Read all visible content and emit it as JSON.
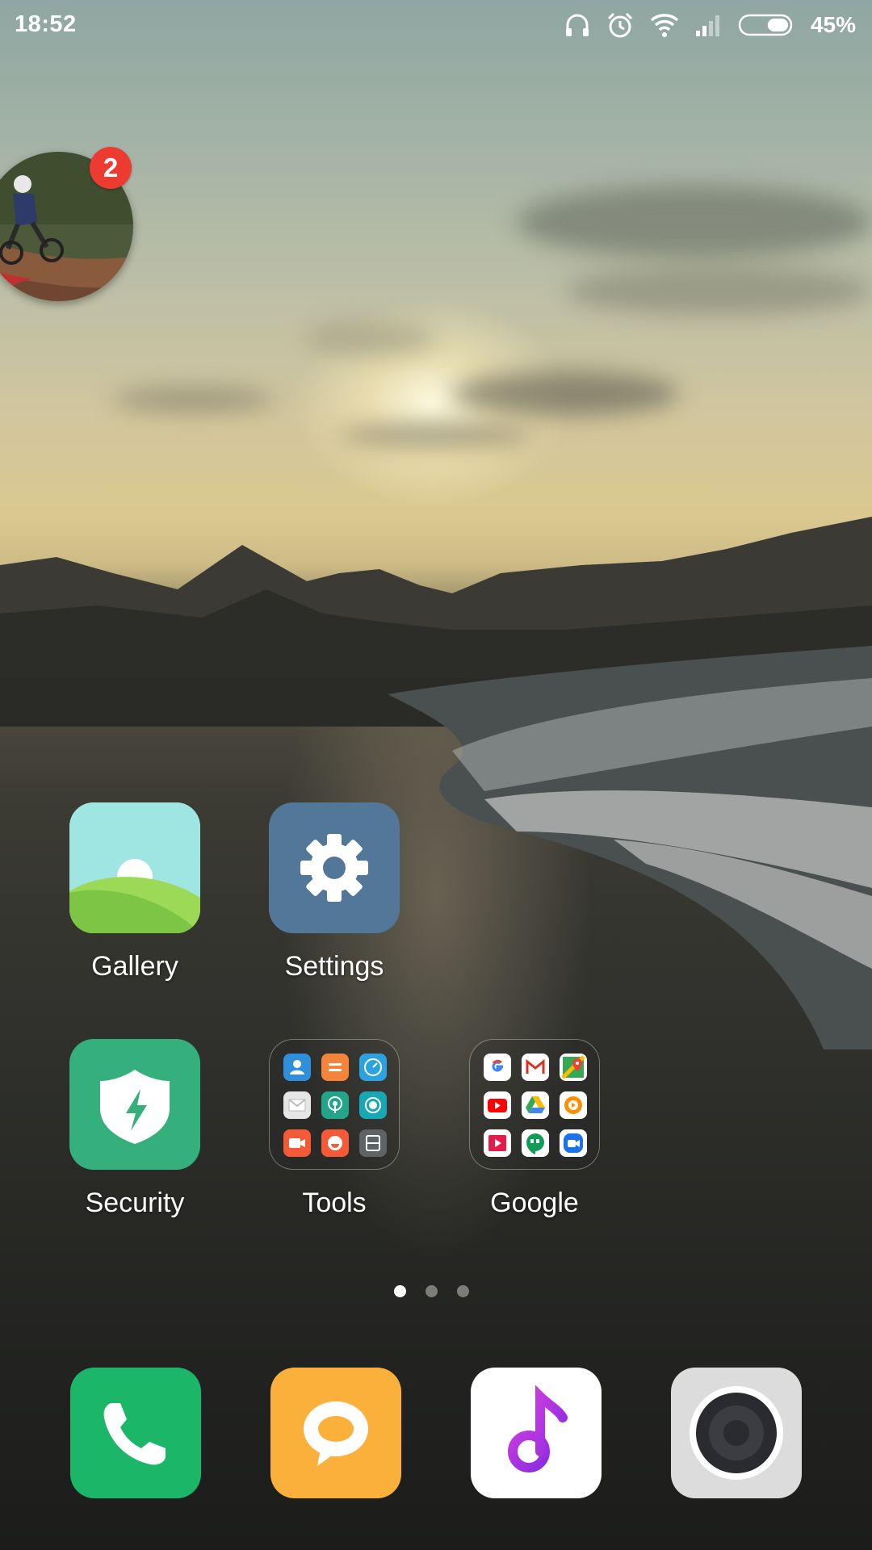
{
  "status_bar": {
    "time": "18:52",
    "battery_percent": "45%",
    "battery_level": 0.45,
    "icons": [
      "headphones-icon",
      "alarm-icon",
      "wifi-icon",
      "signal-icon",
      "battery-icon"
    ]
  },
  "chat_head": {
    "badge_count": "2"
  },
  "home": {
    "apps": [
      {
        "label": "Gallery",
        "icon": "gallery-icon",
        "color": "#8fd25a"
      },
      {
        "label": "Settings",
        "icon": "gear-icon",
        "color": "#527798"
      },
      {
        "label": "Security",
        "icon": "shield-bolt-icon",
        "color": "#35b07d"
      },
      {
        "label": "Tools",
        "icon": "folder-icon"
      },
      {
        "label": "Google",
        "icon": "folder-icon"
      }
    ],
    "tools_folder_icons": [
      "contacts-icon",
      "notes-icon",
      "compass-icon",
      "mail-icon",
      "radio-icon",
      "recorder-icon",
      "screen-recorder-icon",
      "feedback-icon",
      "scanner-icon"
    ],
    "google_folder_icons": [
      "google-icon",
      "gmail-icon",
      "maps-icon",
      "youtube-icon",
      "drive-icon",
      "play-music-icon",
      "play-movies-icon",
      "hangouts-icon",
      "duo-icon"
    ]
  },
  "pager": {
    "pages": 3,
    "current": 1
  },
  "dock": [
    {
      "name": "phone",
      "icon": "phone-icon",
      "color": "#1bb667"
    },
    {
      "name": "messaging",
      "icon": "message-bubble-icon",
      "color": "#fbb03b"
    },
    {
      "name": "music",
      "icon": "music-note-icon",
      "color": "#ffffff"
    },
    {
      "name": "camera",
      "icon": "camera-lens-icon",
      "color": "#dcdcdc"
    }
  ]
}
